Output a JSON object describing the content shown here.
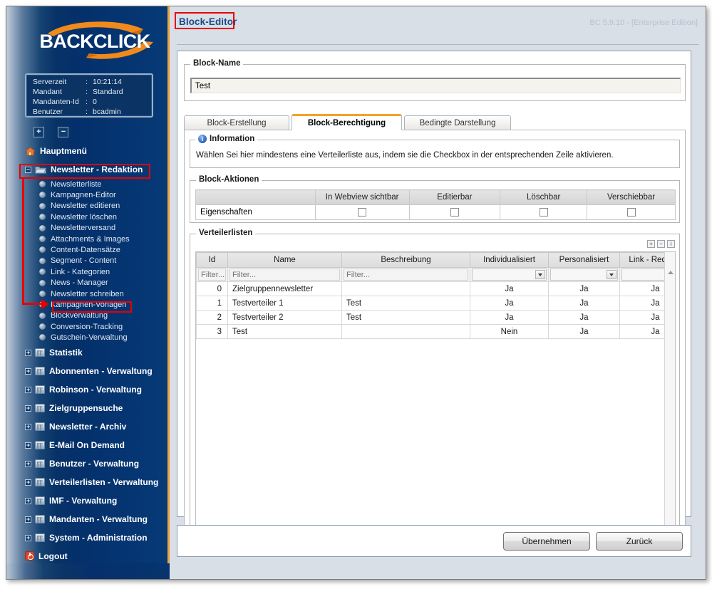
{
  "app": {
    "brand": "BACKCLICK",
    "version_text": "BC 5.9.10 - [Enterprise Edition]"
  },
  "sidebar": {
    "info": {
      "rows": [
        {
          "key": "Serverzeit",
          "sep": ":",
          "value": "10:21:14"
        },
        {
          "key": "Mandant",
          "sep": ":",
          "value": "Standard"
        },
        {
          "key": "Mandanten-Id",
          "sep": ":",
          "value": "0"
        },
        {
          "key": "Benutzer",
          "sep": ":",
          "value": "bcadmin"
        }
      ]
    },
    "mini_buttons": {
      "expand_all": "+",
      "collapse_all": "−"
    },
    "nav": [
      {
        "label": "Hauptmenü",
        "icon": "house-icon",
        "expander": null,
        "level": "top"
      },
      {
        "label": "Newsletter - Redaktion",
        "icon": "open-folder-icon",
        "expander": "−",
        "level": "top",
        "highlighted": true
      },
      {
        "label": "Newsletterliste",
        "icon": "globe-icon",
        "level": "sub"
      },
      {
        "label": "Kampagnen-Editor",
        "icon": "globe-icon",
        "level": "sub"
      },
      {
        "label": "Newsletter editieren",
        "icon": "globe-icon",
        "level": "sub"
      },
      {
        "label": "Newsletter löschen",
        "icon": "globe-icon",
        "level": "sub"
      },
      {
        "label": "Newsletterversand",
        "icon": "globe-icon",
        "level": "sub"
      },
      {
        "label": "Attachments & Images",
        "icon": "globe-icon",
        "level": "sub"
      },
      {
        "label": "Content-Datensätze",
        "icon": "globe-icon",
        "level": "sub"
      },
      {
        "label": "Segment - Content",
        "icon": "globe-icon",
        "level": "sub"
      },
      {
        "label": "Link - Kategorien",
        "icon": "globe-icon",
        "level": "sub"
      },
      {
        "label": "News - Manager",
        "icon": "globe-icon",
        "level": "sub"
      },
      {
        "label": "Newsletter schreiben",
        "icon": "globe-icon",
        "level": "sub"
      },
      {
        "label": "Kampagnen-Vorlagen",
        "icon": "globe-icon",
        "level": "sub"
      },
      {
        "label": "Blockverwaltung",
        "icon": "globe-icon",
        "level": "sub",
        "highlighted": true
      },
      {
        "label": "Conversion-Tracking",
        "icon": "globe-icon",
        "level": "sub"
      },
      {
        "label": "Gutschein-Verwaltung",
        "icon": "globe-icon",
        "level": "sub"
      },
      {
        "label": "Statistik",
        "icon": "folder-icon",
        "expander": "+",
        "level": "top"
      },
      {
        "label": "Abonnenten - Verwaltung",
        "icon": "folder-icon",
        "expander": "+",
        "level": "top"
      },
      {
        "label": "Robinson - Verwaltung",
        "icon": "folder-icon",
        "expander": "+",
        "level": "top"
      },
      {
        "label": "Zielgruppensuche",
        "icon": "folder-icon",
        "expander": "+",
        "level": "top"
      },
      {
        "label": "Newsletter - Archiv",
        "icon": "folder-icon",
        "expander": "+",
        "level": "top"
      },
      {
        "label": "E-Mail On Demand",
        "icon": "folder-icon",
        "expander": "+",
        "level": "top"
      },
      {
        "label": "Benutzer - Verwaltung",
        "icon": "folder-icon",
        "expander": "+",
        "level": "top"
      },
      {
        "label": "Verteilerlisten - Verwaltung",
        "icon": "folder-icon",
        "expander": "+",
        "level": "top"
      },
      {
        "label": "IMF - Verwaltung",
        "icon": "folder-icon",
        "expander": "+",
        "level": "top"
      },
      {
        "label": "Mandanten - Verwaltung",
        "icon": "folder-icon",
        "expander": "+",
        "level": "top"
      },
      {
        "label": "System - Administration",
        "icon": "folder-icon",
        "expander": "+",
        "level": "top"
      },
      {
        "label": "Logout",
        "icon": "logout-icon",
        "expander": null,
        "level": "top"
      }
    ]
  },
  "page": {
    "title": "Block-Editor",
    "blockname": {
      "legend": "Block-Name",
      "value": "Test",
      "placeholder": ""
    },
    "tabs": [
      {
        "label": "Block-Erstellung",
        "active": false
      },
      {
        "label": "Block-Berechtigung",
        "active": true
      },
      {
        "label": "Bedingte Darstellung",
        "active": false
      }
    ],
    "information": {
      "legend": "Information",
      "text": "Wählen Sei hier mindestens eine Verteilerliste aus, indem sie die Checkbox in der entsprechenden Zeile aktivieren."
    },
    "block_aktionen": {
      "legend": "Block-Aktionen",
      "columns": [
        "",
        "In Webview sichtbar",
        "Editierbar",
        "Löschbar",
        "Verschiebbar"
      ],
      "rows": [
        {
          "label": "Eigenschaften",
          "webview": false,
          "editierbar": false,
          "loeschbar": false,
          "verschiebbar": false
        }
      ]
    },
    "verteilerlisten": {
      "legend": "Verteilerlisten",
      "tools": [
        "+",
        "−",
        "i"
      ],
      "columns": [
        "Id",
        "Name",
        "Beschreibung",
        "Individualisiert",
        "Personalisiert",
        "Link - Redirect",
        ""
      ],
      "filters": {
        "id": "Filter...",
        "name": "Filter...",
        "beschreibung": "Filter...",
        "individualisiert": "",
        "personalisiert": "",
        "link_redirect": ""
      },
      "rows": [
        {
          "id": "0",
          "name": "Zielgruppennewsletter",
          "beschreibung": "",
          "individualisiert": "Ja",
          "personalisiert": "Ja",
          "link_redirect": "Ja",
          "selected": false
        },
        {
          "id": "1",
          "name": "Testverteiler 1",
          "beschreibung": "Test",
          "individualisiert": "Ja",
          "personalisiert": "Ja",
          "link_redirect": "Ja",
          "selected": false
        },
        {
          "id": "2",
          "name": "Testverteiler 2",
          "beschreibung": "Test",
          "individualisiert": "Ja",
          "personalisiert": "Ja",
          "link_redirect": "Ja",
          "selected": false
        },
        {
          "id": "3",
          "name": "Test",
          "beschreibung": "",
          "individualisiert": "Nein",
          "personalisiert": "Ja",
          "link_redirect": "Ja",
          "selected": false
        }
      ]
    },
    "actions": {
      "submit_label": "Übernehmen",
      "back_label": "Zurück"
    }
  },
  "annotations": {
    "color": "#e80000",
    "boxes": [
      "Block-Editor",
      "Newsletter - Redaktion",
      "Blockverwaltung"
    ]
  },
  "colors": {
    "brand_navy": "#06306b",
    "brand_orange": "#f0a32b",
    "accent_blue": "#1a4a86",
    "annotation_red": "#e80000",
    "page_bg": "#d8dfe7"
  }
}
